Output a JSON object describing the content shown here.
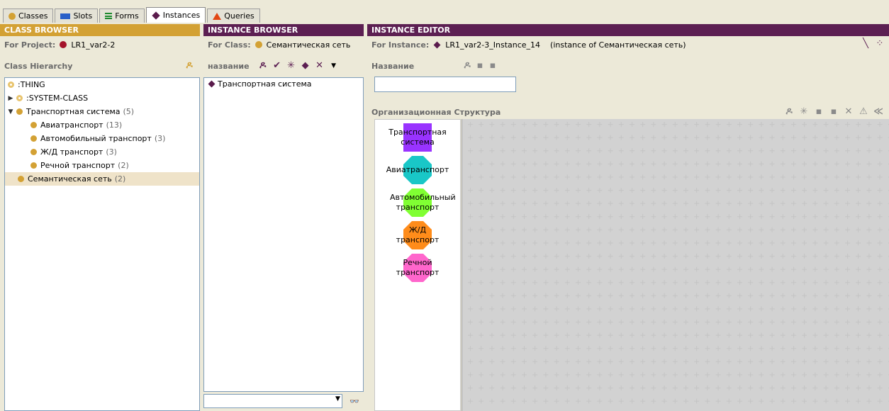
{
  "tabs": [
    {
      "label": "Classes",
      "icon": "class-dot-icon",
      "color": "#d3a134"
    },
    {
      "label": "Slots",
      "icon": "slots-icon",
      "color": "#2a60c8"
    },
    {
      "label": "Forms",
      "icon": "forms-icon",
      "color": "#1e8a2e"
    },
    {
      "label": "Instances",
      "icon": "instance-diamond-icon",
      "color": "#5a1b4c"
    },
    {
      "label": "Queries",
      "icon": "queries-triangle-icon",
      "color": "#e24612"
    }
  ],
  "class_browser": {
    "title": "CLASS BROWSER",
    "project_label": "For Project:",
    "project_name": "LR1_var2-2",
    "hierarchy_label": "Class Hierarchy",
    "tree": [
      {
        "label": ":THING",
        "count": "",
        "level": 0
      },
      {
        "label": ":SYSTEM-CLASS",
        "count": "",
        "level": 0
      },
      {
        "label": "Транспортная система",
        "count": "(5)",
        "level": 0
      },
      {
        "label": "Авиатранспорт",
        "count": "(13)",
        "level": 1
      },
      {
        "label": "Автомобильный транспорт",
        "count": "(3)",
        "level": 1
      },
      {
        "label": "Ж/Д транспорт",
        "count": "(3)",
        "level": 1
      },
      {
        "label": "Речной транспорт",
        "count": "(2)",
        "level": 1
      },
      {
        "label": "Семантическая сеть",
        "count": "(2)",
        "level": 0,
        "selected": true
      }
    ]
  },
  "instance_browser": {
    "title": "INSTANCE BROWSER",
    "class_label": "For Class:",
    "class_name": "Семантическая сеть",
    "column_label": "название",
    "instances": [
      "Транспортная система"
    ],
    "search_value": ""
  },
  "instance_editor": {
    "title": "INSTANCE EDITOR",
    "instance_label": "For Instance:",
    "instance_name": "LR1_var2-3_Instance_14",
    "instance_of": "(instance of Семантическая сеть)",
    "name_label": "Название",
    "name_value": "",
    "structure_label": "Организационная Структура",
    "legend": [
      {
        "label": "Транспортная система",
        "shape": "square",
        "color": "#9933ff"
      },
      {
        "label": "Авиатранспорт",
        "shape": "octagon",
        "color": "#19c7c7"
      },
      {
        "label": "Автомобильный транспорт",
        "shape": "octagon",
        "color": "#80ff33"
      },
      {
        "label": "Ж/Д транспорт",
        "shape": "octagon",
        "color": "#ff8c1a"
      },
      {
        "label": "Речной транспорт",
        "shape": "octagon",
        "color": "#ff66cc"
      }
    ]
  }
}
